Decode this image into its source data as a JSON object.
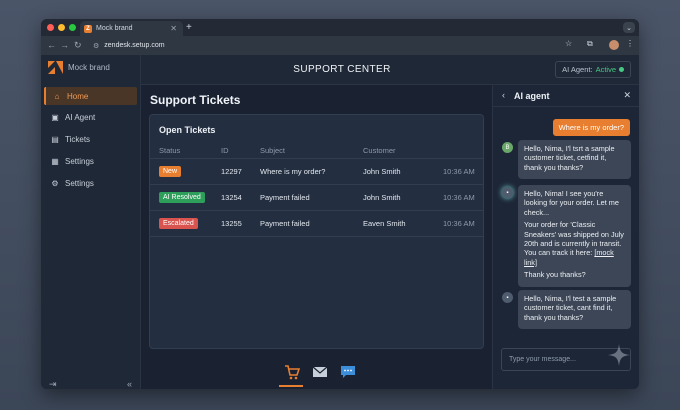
{
  "browser": {
    "tab_title": "Mock brand",
    "url": "zendesk.setup.com",
    "traffic_lights": [
      "#ff5f57",
      "#febc2e",
      "#28c840"
    ]
  },
  "sidebar": {
    "brand": "Mock brand",
    "items": [
      {
        "label": "Home",
        "icon": "home-icon",
        "active": true
      },
      {
        "label": "AI Agent",
        "icon": "ai-agent-icon",
        "active": false
      },
      {
        "label": "Tickets",
        "icon": "tickets-icon",
        "active": false
      },
      {
        "label": "Settings",
        "icon": "settings-doc-icon",
        "active": false
      },
      {
        "label": "Settings",
        "icon": "gear-icon",
        "active": false
      }
    ]
  },
  "header": {
    "title": "SUPPORT CENTER",
    "ai_status_label": "AI Agent:",
    "ai_status_value": "Active"
  },
  "main": {
    "page_title": "Support Tickets",
    "card_title": "Open Tickets",
    "columns": [
      "Status",
      "ID",
      "Subject",
      "Customer"
    ],
    "rows": [
      {
        "status": "New",
        "status_color": "#e87e2f",
        "id": "12297",
        "subject": "Where is my order?",
        "customer": "John Smith",
        "time": "10:36 AM"
      },
      {
        "status": "AI Resolved",
        "status_color": "#2e9e5b",
        "id": "13254",
        "subject": "Payment failed",
        "customer": "John Smith",
        "time": "10:36 AM"
      },
      {
        "status": "Escalated",
        "status_color": "#d9534f",
        "id": "13255",
        "subject": "Payment failed",
        "customer": "Eaven Smith",
        "time": "10:36 AM"
      }
    ]
  },
  "ai_panel": {
    "title": "AI agent",
    "user_message": "Where is my order?",
    "messages": [
      {
        "lines": [
          "Hello, Nima, I'l tsrt a sample customer ticket, cetfind it, thank you thanks?"
        ]
      },
      {
        "lines": [
          "Hello, Nima! I see you're looking for your order. Let me check...",
          "Your order for 'Classic Sneakers' was shipped on July 20th and is currently in transit. You can track it here: ",
          "Thank you thanks?"
        ],
        "link": "[mock link]"
      },
      {
        "lines": [
          "Hello, Nima, I'l test a sample customer ticket, cant find it, thank you thanks?"
        ]
      }
    ],
    "input_placeholder": "Type your message..."
  },
  "colors": {
    "accent": "#e87e2f",
    "active_green": "#48c985",
    "background": "#1a2232"
  }
}
